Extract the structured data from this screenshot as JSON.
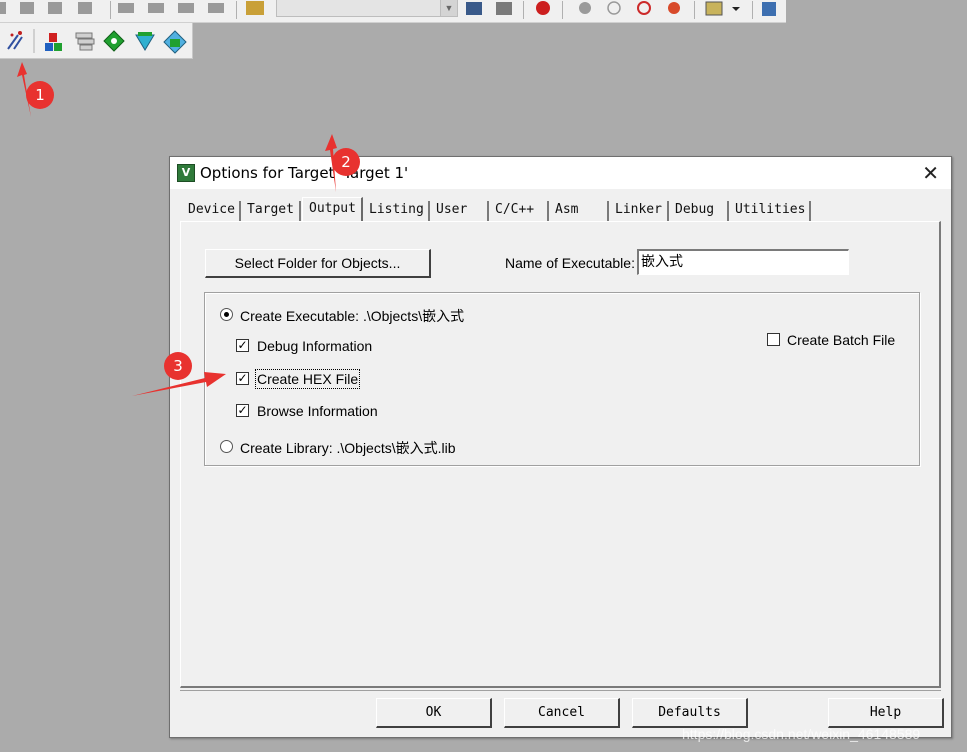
{
  "dialog": {
    "title": "Options for Target 'Target 1'",
    "title_icon_glyph": "V",
    "close_glyph": "✕",
    "tabs": [
      {
        "label": "Device"
      },
      {
        "label": "Target"
      },
      {
        "label": "Output"
      },
      {
        "label": "Listing"
      },
      {
        "label": "User"
      },
      {
        "label": "C/C++"
      },
      {
        "label": "Asm"
      },
      {
        "label": "Linker"
      },
      {
        "label": "Debug"
      },
      {
        "label": "Utilities"
      }
    ],
    "active_tab": "Output",
    "select_folder_button": "Select Folder for Objects...",
    "name_of_executable_label": "Name of Executable:",
    "name_of_executable_value": "嵌入式",
    "create_executable_label": "Create Executable:  .\\Objects\\嵌入式",
    "create_executable_selected": true,
    "debug_information_label": "Debug Information",
    "debug_information_checked": true,
    "create_hex_label": "Create HEX File",
    "create_hex_checked": true,
    "browse_information_label": "Browse Information",
    "browse_information_checked": true,
    "create_library_label": "Create Library:  .\\Objects\\嵌入式.lib",
    "create_library_selected": false,
    "create_batch_label": "Create Batch File",
    "create_batch_checked": false,
    "ok_button": "OK",
    "cancel_button": "Cancel",
    "defaults_button": "Defaults",
    "help_button": "Help"
  },
  "annotations": [
    "1",
    "2",
    "3"
  ],
  "watermark": "https://blog.csdn.net/weixin_46148589",
  "colors": {
    "annotation_red": "#e8322f",
    "desktop_gray": "#ababab",
    "dialog_face": "#f0f0f0"
  }
}
